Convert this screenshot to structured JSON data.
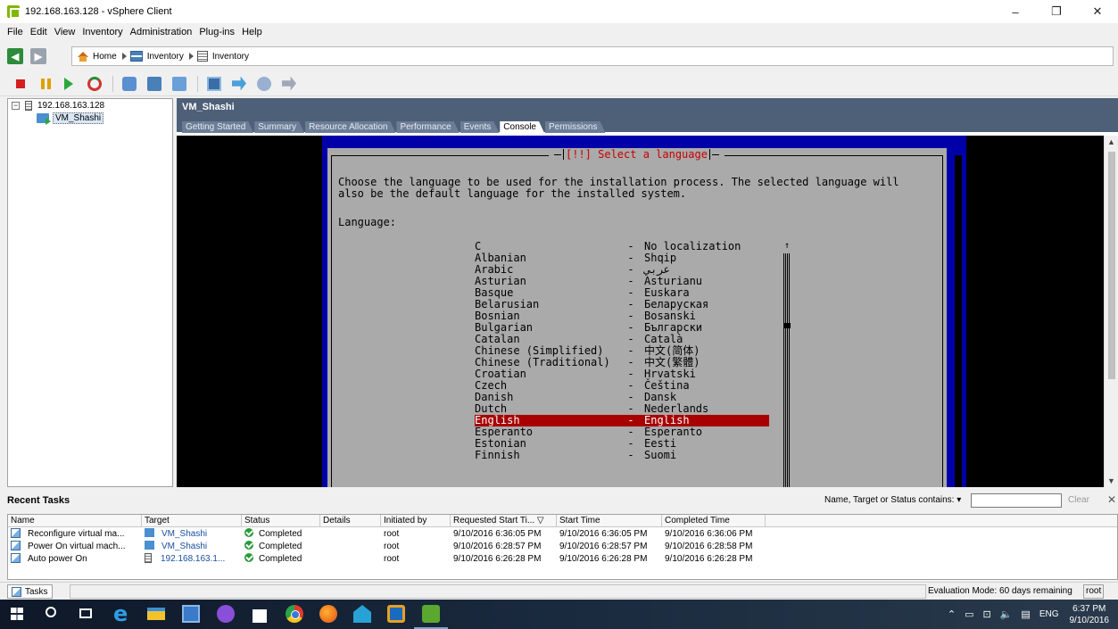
{
  "window": {
    "title": "192.168.163.128 - vSphere Client",
    "controls": {
      "minimize": "–",
      "maximize": "❐",
      "close": "✕"
    }
  },
  "menu": [
    "File",
    "Edit",
    "View",
    "Inventory",
    "Administration",
    "Plug-ins",
    "Help"
  ],
  "breadcrumb": {
    "home": "Home",
    "items": [
      "Inventory",
      "Inventory"
    ]
  },
  "tree": {
    "host": "192.168.163.128",
    "vm": "VM_Shashi",
    "expander": "−"
  },
  "vm_panel": {
    "title": "VM_Shashi",
    "tabs": [
      "Getting Started",
      "Summary",
      "Resource Allocation",
      "Performance",
      "Events",
      "Console",
      "Permissions"
    ],
    "active_tab": "Console"
  },
  "console": {
    "dialog_title": "[!!] Select a language",
    "description": "Choose the language to be used for the installation process. The selected language will\nalso be the default language for the installed system.",
    "language_label": "Language:",
    "scroll_up": "↑",
    "languages": [
      {
        "name": "C",
        "native": "No localization",
        "selected": false
      },
      {
        "name": "Albanian",
        "native": "Shqip",
        "selected": false
      },
      {
        "name": "Arabic",
        "native": "عربي",
        "selected": false
      },
      {
        "name": "Asturian",
        "native": "Asturianu",
        "selected": false
      },
      {
        "name": "Basque",
        "native": "Euskara",
        "selected": false
      },
      {
        "name": "Belarusian",
        "native": "Беларуская",
        "selected": false
      },
      {
        "name": "Bosnian",
        "native": "Bosanski",
        "selected": false
      },
      {
        "name": "Bulgarian",
        "native": "Български",
        "selected": false
      },
      {
        "name": "Catalan",
        "native": "Català",
        "selected": false
      },
      {
        "name": "Chinese (Simplified)",
        "native": "中文(简体)",
        "selected": false
      },
      {
        "name": "Chinese (Traditional)",
        "native": "中文(繁體)",
        "selected": false
      },
      {
        "name": "Croatian",
        "native": "Hrvatski",
        "selected": false
      },
      {
        "name": "Czech",
        "native": "Čeština",
        "selected": false
      },
      {
        "name": "Danish",
        "native": "Dansk",
        "selected": false
      },
      {
        "name": "Dutch",
        "native": "Nederlands",
        "selected": false
      },
      {
        "name": "English",
        "native": "English",
        "selected": true
      },
      {
        "name": "Esperanto",
        "native": "Esperanto",
        "selected": false
      },
      {
        "name": "Estonian",
        "native": "Eesti",
        "selected": false
      },
      {
        "name": "Finnish",
        "native": "Suomi",
        "selected": false
      }
    ],
    "separator": "-",
    "colors": {
      "screen": "#0000a8",
      "dialog": "#aaaaaa",
      "selection": "#a80000",
      "title": "#c80000"
    }
  },
  "tasks": {
    "title": "Recent Tasks",
    "filter_label": "Name, Target or Status contains: ▾",
    "filter_value": "",
    "clear_label": "Clear",
    "close": "✕",
    "columns": [
      "Name",
      "Target",
      "Status",
      "Details",
      "Initiated by",
      "Requested Start Ti... ▽",
      "Start Time",
      "Completed Time"
    ],
    "rows": [
      {
        "name": "Reconfigure virtual ma...",
        "target": "VM_Shashi",
        "status": "Completed",
        "details": "",
        "initiated_by": "root",
        "requested": "9/10/2016 6:36:05 PM",
        "start": "9/10/2016 6:36:05 PM",
        "completed": "9/10/2016 6:36:06 PM"
      },
      {
        "name": "Power On virtual mach...",
        "target": "VM_Shashi",
        "status": "Completed",
        "details": "",
        "initiated_by": "root",
        "requested": "9/10/2016 6:28:57 PM",
        "start": "9/10/2016 6:28:57 PM",
        "completed": "9/10/2016 6:28:58 PM"
      },
      {
        "name": "Auto power On",
        "target": "192.168.163.1...",
        "status": "Completed",
        "details": "",
        "initiated_by": "root",
        "requested": "9/10/2016 6:26:28 PM",
        "start": "9/10/2016 6:26:28 PM",
        "completed": "9/10/2016 6:26:28 PM"
      }
    ]
  },
  "statusbar": {
    "tasks_tab": "Tasks",
    "evaluation": "Evaluation Mode: 60 days remaining",
    "user": "root"
  },
  "taskbar": {
    "edge_glyph": "e",
    "tray_up": "⌃",
    "tray_glyphs": [
      "▭",
      "⊡",
      "🔈",
      "▤"
    ],
    "language": "ENG",
    "time": "6:37 PM",
    "date": "9/10/2016"
  }
}
